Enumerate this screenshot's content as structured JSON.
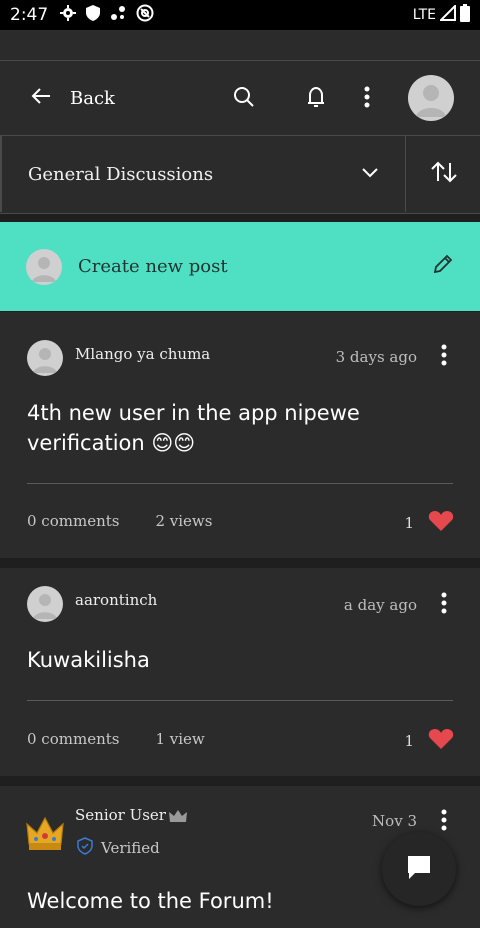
{
  "status_bar": {
    "time": "2:47",
    "network": "LTE"
  },
  "topbar": {
    "back_label": "Back"
  },
  "filter": {
    "category": "General Discussions"
  },
  "create_post": {
    "label": "Create new post"
  },
  "posts": [
    {
      "author": "Mlango ya chuma",
      "time": "3 days ago",
      "title": "4th new user in the app nipewe verification 😊😊",
      "comments": "0 comments",
      "views": "2 views",
      "likes": "1"
    },
    {
      "author": "aarontinch",
      "time": "a day ago",
      "title": "Kuwakilisha",
      "comments": "0 comments",
      "views": "1 view",
      "likes": "1"
    },
    {
      "author": "Senior User",
      "badge": "Verified",
      "time": "Nov 3",
      "title": "Welcome to the Forum!"
    }
  ],
  "colors": {
    "accent": "#4fe0c3",
    "heart": "#e5484d",
    "background": "#1f1f1f",
    "card": "#2b2b2b"
  }
}
